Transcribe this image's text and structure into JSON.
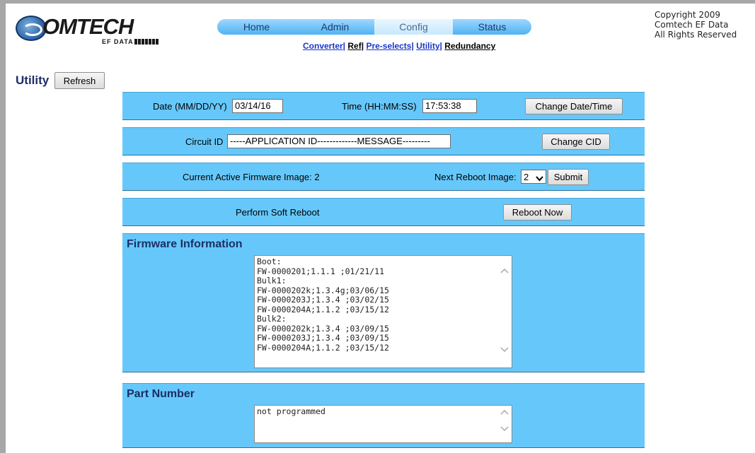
{
  "logo": {
    "word": "OMTECH",
    "sub": "EF DATA"
  },
  "nav": {
    "tabs": [
      "Home",
      "Admin",
      "Config",
      "Status"
    ],
    "active": "Config",
    "sub": [
      {
        "label": "Converter|",
        "link": true
      },
      {
        "label": "Ref|",
        "link": false
      },
      {
        "label": "Pre-selects|",
        "link": true
      },
      {
        "label": "Utility|",
        "link": true
      },
      {
        "label": "Redundancy",
        "link": false
      }
    ]
  },
  "copyright": [
    "Copyright 2009",
    "Comtech EF Data",
    "All Rights Reserved"
  ],
  "page": {
    "title": "Utility",
    "refresh_label": "Refresh"
  },
  "datetime": {
    "date_label": "Date (MM/DD/YY)",
    "date_value": "03/14/16",
    "time_label": "Time (HH:MM:SS)",
    "time_value": "17:53:38",
    "button": "Change Date/Time"
  },
  "circuit": {
    "label": "Circuit ID",
    "value": "-----APPLICATION ID-------------MESSAGE---------",
    "button": "Change CID"
  },
  "firmware_image": {
    "current_label": "Current Active Firmware Image: 2",
    "next_label": "Next Reboot Image:",
    "next_value": "2",
    "submit": "Submit"
  },
  "reboot": {
    "label": "Perform Soft Reboot",
    "button": "Reboot Now"
  },
  "firmware_info": {
    "title": "Firmware Information",
    "text": "Boot:\nFW-0000201;1.1.1 ;01/21/11\nBulk1:\nFW-0000202k;1.3.4g;03/06/15\nFW-0000203J;1.3.4 ;03/02/15\nFW-0000204A;1.1.2 ;03/15/12\nBulk2:\nFW-0000202k;1.3.4 ;03/09/15\nFW-0000203J;1.3.4 ;03/09/15\nFW-0000204A;1.1.2 ;03/15/12"
  },
  "part_number": {
    "title": "Part Number",
    "text": "not programmed"
  },
  "colors": {
    "panel": "#66c8fa",
    "title": "#1c2e66",
    "link": "#1a36c8"
  },
  "icons": [
    "comtech-globe-logo",
    "scroll-up-icon",
    "scroll-down-icon",
    "dropdown-arrow-icon"
  ]
}
